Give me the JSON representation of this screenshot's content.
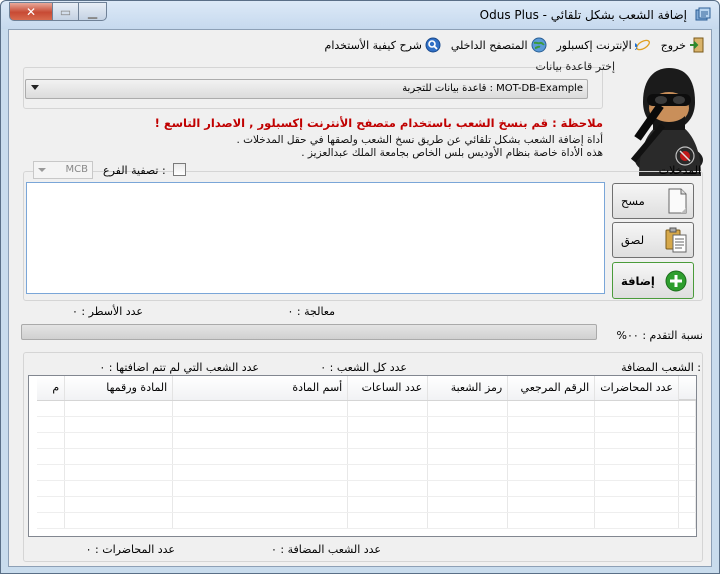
{
  "window": {
    "title": "إضافة الشعب بشكل تلقائي - Odus Plus"
  },
  "toolbar": {
    "items": [
      {
        "label": "شرح كيفية الأستخدام",
        "icon": "help-icon"
      },
      {
        "label": "المتصفح الداخلي",
        "icon": "globe-icon"
      },
      {
        "label": "الإنترنت إكسبلور",
        "icon": "ie-icon"
      },
      {
        "label": "خروج",
        "icon": "exit-icon"
      }
    ]
  },
  "database": {
    "legend": "إختر قاعدة بيانات",
    "selected": "MOT-DB-Example : قاعدة بيانات للتجربة"
  },
  "note": "ملاحظة : قم بنسخ الشعب باستخدام متصفح الأنترنت إكسبلور , الاصدار التاسع !",
  "description": [
    "أداة إضافة الشعب بشكل تلقائي عن طريق نسخ الشعب ولصقها في حقل المدخلات .",
    "هذه الأداة خاصة بنظام الأوديس بلس الخاص بجامعة الملك عبدالعزيز ."
  ],
  "inputs": {
    "legend": "المدخلات",
    "branch_filter_label": "تصفية الفرع :",
    "branch_value": "MCB",
    "clear_label": "مسح",
    "paste_label": "لصق",
    "add_label": "إضافة",
    "lines_count": "عدد الأسطر :  ٠",
    "processing": "معالجة :  ٠"
  },
  "progress": {
    "label": "نسبة التقدم :  ٠٠%",
    "value": 0
  },
  "added": {
    "legend": "الشعب المضافة :",
    "total_sections": "عدد كل الشعب :  ٠",
    "not_added": "عدد الشعب التي لم تتم اضافتها :  ٠",
    "added_sections": "عدد الشعب المضافة :  ٠",
    "lectures_count": "عدد المحاضرات :  ٠"
  },
  "grid": {
    "columns": [
      "عدد المحاضرات",
      "الرقم المرجعي",
      "رمز الشعبة",
      "عدد الساعات",
      "أسم المادة",
      "المادة ورقمها",
      "م"
    ],
    "rows": []
  },
  "colors": {
    "note_red": "#c00000",
    "add_green": "#2e9e2e"
  }
}
